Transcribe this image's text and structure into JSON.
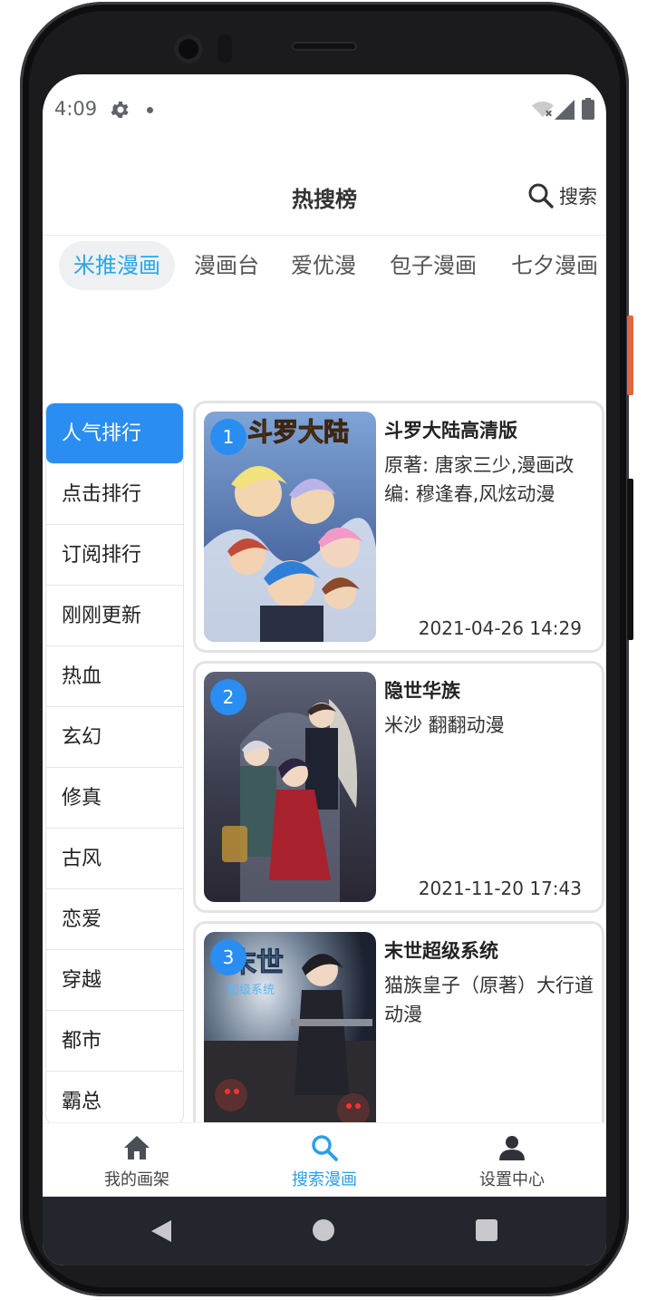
{
  "status": {
    "time": "4:09"
  },
  "header": {
    "title": "热搜榜",
    "search_label": "搜索"
  },
  "tabs": [
    {
      "label": "米推漫画",
      "active": true
    },
    {
      "label": "漫画台",
      "active": false
    },
    {
      "label": "爱优漫",
      "active": false
    },
    {
      "label": "包子漫画",
      "active": false
    },
    {
      "label": "七夕漫画",
      "active": false
    }
  ],
  "categories": [
    {
      "label": "人气排行",
      "active": true
    },
    {
      "label": "点击排行"
    },
    {
      "label": "订阅排行"
    },
    {
      "label": "刚刚更新"
    },
    {
      "label": "热血"
    },
    {
      "label": "玄幻"
    },
    {
      "label": "修真"
    },
    {
      "label": "古风"
    },
    {
      "label": "恋爱"
    },
    {
      "label": "穿越"
    },
    {
      "label": "都市"
    },
    {
      "label": "霸总"
    }
  ],
  "comics": [
    {
      "rank": "1",
      "title": "斗罗大陆高清版",
      "author": "原著: 唐家三少,漫画改编: 穆逢春,风炫动漫",
      "date": "2021-04-26 14:29",
      "cover_text": "斗罗大陆"
    },
    {
      "rank": "2",
      "title": "隐世华族",
      "author": "米沙 翻翻动漫",
      "date": "2021-11-20 17:43"
    },
    {
      "rank": "3",
      "title": "末世超级系统",
      "author": "猫族皇子（原著）大行道动漫",
      "date": "",
      "cover_text": "末世",
      "cover_subtext": "超级系统"
    }
  ],
  "bottom_nav": [
    {
      "label": "我的画架",
      "icon": "home-icon",
      "active": false
    },
    {
      "label": "搜索漫画",
      "icon": "search-icon",
      "active": true
    },
    {
      "label": "设置中心",
      "icon": "person-icon",
      "active": false
    }
  ],
  "colors": {
    "accent": "#2a8df1",
    "tab_active_text": "#2ba6e8",
    "nav_active": "#2a9ee8"
  }
}
